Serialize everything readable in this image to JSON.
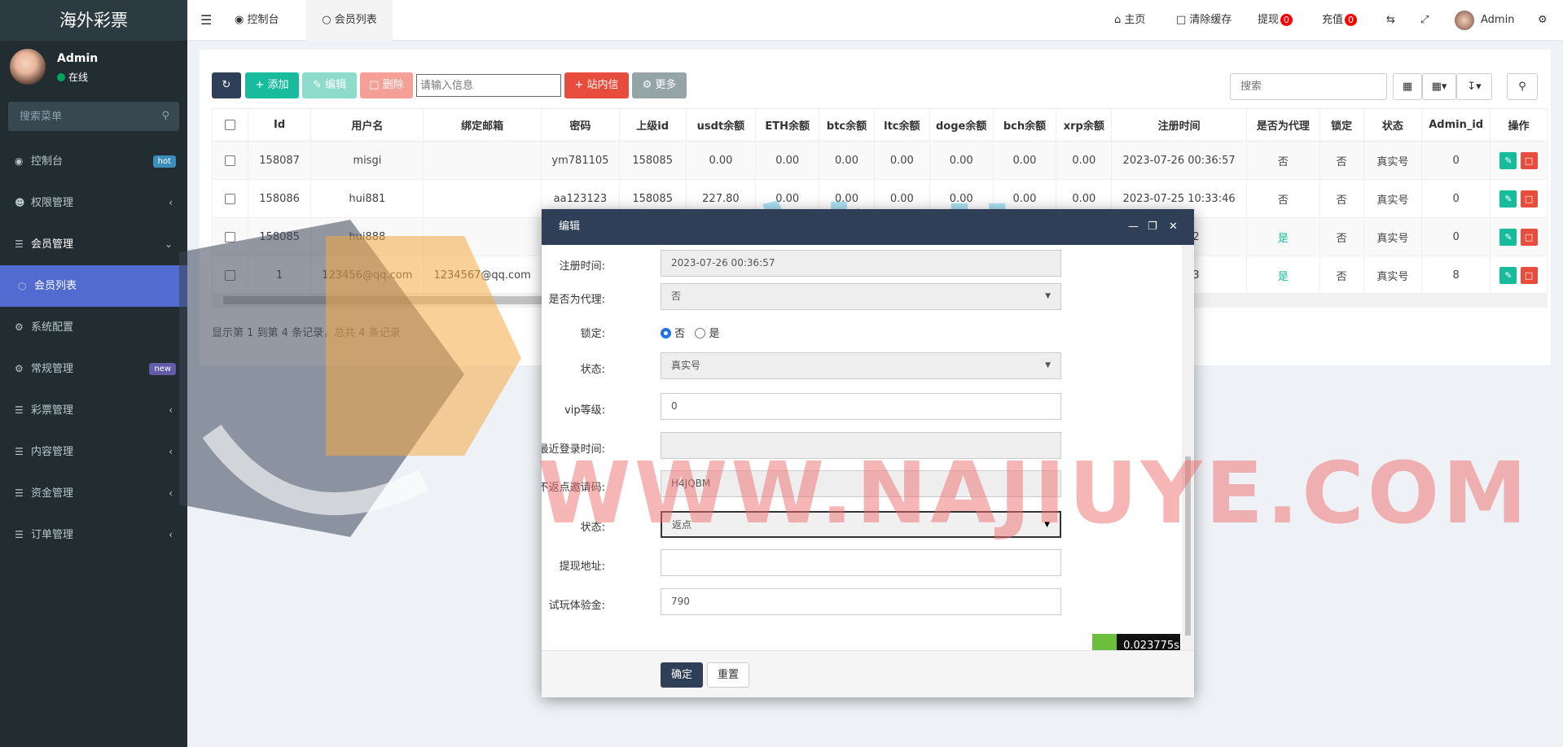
{
  "app_title": "海外彩票",
  "user": {
    "name": "Admin",
    "status": "在线"
  },
  "menu_search_placeholder": "搜索菜单",
  "menu": [
    {
      "label": "控制台",
      "icon": "dashboard-icon",
      "badge": "hot",
      "badge_color": "#3c8dbc"
    },
    {
      "label": "权限管理",
      "icon": "group-icon"
    },
    {
      "label": "会员管理",
      "icon": "list-icon"
    },
    {
      "label": "会员列表",
      "icon": "circle-icon"
    },
    {
      "label": "系统配置",
      "icon": "gear-icon"
    },
    {
      "label": "常规管理",
      "icon": "gears-icon",
      "badge": "new",
      "badge_color": "#605ca8"
    },
    {
      "label": "彩票管理",
      "icon": "list-icon"
    },
    {
      "label": "内容管理",
      "icon": "list-icon"
    },
    {
      "label": "资金管理",
      "icon": "list-icon"
    },
    {
      "label": "订单管理",
      "icon": "list-icon"
    }
  ],
  "tabs": [
    "控制台",
    "会员列表"
  ],
  "topnav": {
    "home": "主页",
    "clear_cache": "清除缓存",
    "withdraw": "提现",
    "withdraw_count": "0",
    "recharge": "充值",
    "recharge_count": "0",
    "admin": "Admin"
  },
  "toolbar": {
    "add": "添加",
    "edit": "编辑",
    "delete": "删除",
    "search_placeholder": "请输入信息",
    "message": "站内信",
    "more": "更多",
    "right_search_placeholder": "搜索"
  },
  "table": {
    "columns": [
      "Id",
      "用户名",
      "绑定邮箱",
      "密码",
      "上级id",
      "usdt余额",
      "ETH余额",
      "btc余额",
      "ltc余额",
      "doge余额",
      "bch余额",
      "xrp余额",
      "注册时间",
      "是否为代理",
      "锁定",
      "状态",
      "Admin_id",
      "操作"
    ],
    "rows": [
      [
        "158087",
        "misgi",
        "",
        "ym781105",
        "158085",
        "0.00",
        "0.00",
        "0.00",
        "0.00",
        "0.00",
        "0.00",
        "0.00",
        "2023-07-26 00:36:57",
        "否",
        "否",
        "真实号",
        "0"
      ],
      [
        "158086",
        "hui881",
        "",
        "aa123123",
        "158085",
        "227.80",
        "0.00",
        "0.00",
        "0.00",
        "0.00",
        "0.00",
        "0.00",
        "2023-07-25 10:33:46",
        "否",
        "否",
        "真实号",
        "0"
      ],
      [
        "158085",
        "hui888",
        "",
        "",
        "",
        "",
        "",
        "",
        "",
        "",
        "",
        "",
        "0:30:52",
        "是",
        "否",
        "真实号",
        "0"
      ],
      [
        "1",
        "123456@qq.com",
        "1234567@qq.com",
        "",
        "",
        "",
        "",
        "",
        "",
        "",
        "",
        "",
        "0:40:33",
        "是",
        "否",
        "真实号",
        "8"
      ]
    ],
    "footer": "显示第 1 到第 4 条记录，总共 4 条记录"
  },
  "modal": {
    "title": "编辑",
    "fields": {
      "reg_time_label": "注册时间:",
      "reg_time": "2023-07-26 00:36:57",
      "agent_label": "是否为代理:",
      "agent": "否",
      "lock_label": "锁定:",
      "lock_no": "否",
      "lock_yes": "是",
      "status_label": "状态:",
      "status": "真实号",
      "vip_label": "vip等级:",
      "vip": "0",
      "last_login_label": "最近登录时间:",
      "last_login": "",
      "invite_label": "不返点邀请码:",
      "invite": "H4JQBM",
      "rebate_label": "状态:",
      "rebate": "返点",
      "withdraw_addr_label": "提现地址:",
      "withdraw_addr": "",
      "trial_label": "试玩体验金:",
      "trial": "790"
    },
    "timer": "0.023775s",
    "confirm": "确定",
    "reset": "重置"
  },
  "watermark": {
    "text": "WWW.NAJIUYE.COM",
    "cn_text": "那就业"
  }
}
